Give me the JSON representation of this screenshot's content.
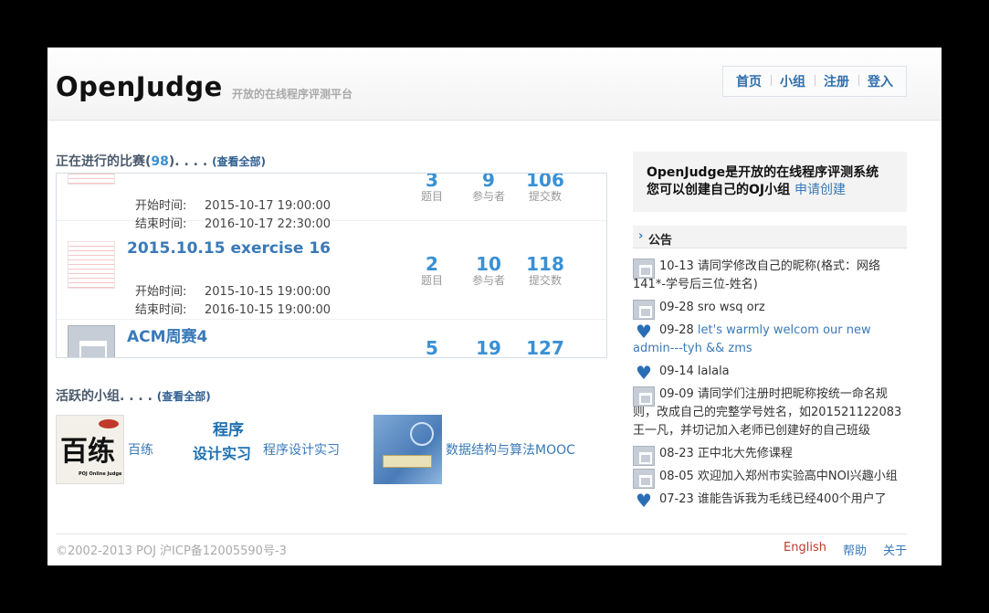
{
  "header": {
    "logo": "OpenJudge",
    "slogan": "开放的在线程序评测平台",
    "nav": [
      "首页",
      "小组",
      "注册",
      "登入"
    ]
  },
  "contests_section": {
    "title": "正在进行的比赛(",
    "count": "98",
    "title_tail": "). . . .",
    "view_all": "(查看全部)"
  },
  "contests": [
    {
      "title": "",
      "start_label": "开始时间:",
      "start": "2015-10-17 19:00:00",
      "end_label": "结束时间:",
      "end": "2016-10-17 22:30:00",
      "problems": "3",
      "participants": "9",
      "submissions": "106"
    },
    {
      "title": "2015.10.15 exercise 16",
      "start_label": "开始时间:",
      "start": "2015-10-15 19:00:00",
      "end_label": "结束时间:",
      "end": "2016-10-15 19:00:00",
      "problems": "2",
      "participants": "10",
      "submissions": "118"
    },
    {
      "title": "ACM周赛4",
      "problems": "5",
      "participants": "19",
      "submissions": "127"
    }
  ],
  "stat_labels": {
    "problems": "题目",
    "participants": "参与者",
    "submissions": "提交数"
  },
  "groups_section": {
    "title": "活跃的小组. . . .",
    "view_all": "(查看全部)"
  },
  "groups": [
    {
      "name": "百练",
      "logo_text": "百练",
      "logo_sub": "POJ Online Judge"
    },
    {
      "name": "程序设计实习",
      "logo_top": "程序",
      "logo_bottom": "设计实习"
    },
    {
      "name": "数据结构与算法MOOC"
    }
  ],
  "intro": {
    "line1": "OpenJudge是开放的在线程序评测系统",
    "line2": "您可以创建自己的OJ小组",
    "link": "申请创建"
  },
  "announcements_title": "公告",
  "announcements": [
    {
      "icon": "group-icon",
      "text": "10-13 请同学修改自己的昵称(格式：网络141*-学号后三位-姓名)"
    },
    {
      "icon": "group-icon",
      "text": "09-28 sro wsq orz"
    },
    {
      "icon": "heart-icon",
      "date": "09-28",
      "link": "let's warmly welcom our new admin---tyh && zms"
    },
    {
      "icon": "heart-icon",
      "text": "09-14 lalala"
    },
    {
      "icon": "group-icon",
      "text": "09-09 请同学们注册时把昵称按统一命名规则，改成自己的完整学号姓名，如201521122083王一凡，并切记加入老师已创建好的自己班级"
    },
    {
      "icon": "group-icon",
      "text": "08-23 正中北大先修课程"
    },
    {
      "icon": "group-icon",
      "text": "08-05 欢迎加入郑州市实验高中NOI兴趣小组"
    },
    {
      "icon": "heart-icon",
      "text": "07-23 谁能告诉我为毛线已经400个用户了"
    }
  ],
  "footer": {
    "copyright": "©2002-2013 POJ 沪ICP备12005590号-3",
    "links": [
      "English",
      "帮助",
      "关于"
    ]
  },
  "colors": {
    "link": "#3a79b8",
    "stat": "#3a90d4",
    "english": "#c0392b"
  }
}
